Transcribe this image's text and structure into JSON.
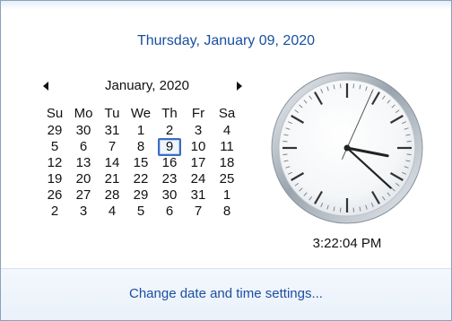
{
  "header": {
    "full_date": "Thursday, January 09, 2020"
  },
  "calendar": {
    "month_label": "January, 2020",
    "weekdays": [
      "Su",
      "Mo",
      "Tu",
      "We",
      "Th",
      "Fr",
      "Sa"
    ],
    "weeks": [
      [
        "29",
        "30",
        "31",
        "1",
        "2",
        "3",
        "4"
      ],
      [
        "5",
        "6",
        "7",
        "8",
        "9",
        "10",
        "11"
      ],
      [
        "12",
        "13",
        "14",
        "15",
        "16",
        "17",
        "18"
      ],
      [
        "19",
        "20",
        "21",
        "22",
        "23",
        "24",
        "25"
      ],
      [
        "26",
        "27",
        "28",
        "29",
        "30",
        "31",
        "1"
      ],
      [
        "2",
        "3",
        "4",
        "5",
        "6",
        "7",
        "8"
      ]
    ],
    "selected_day": "9",
    "prev_icon": "triangle-left-icon",
    "next_icon": "triangle-right-icon"
  },
  "clock": {
    "time_text": "3:22:04 PM",
    "hour": 3,
    "minute": 22,
    "second": 4
  },
  "footer": {
    "link_label": "Change date and time settings..."
  },
  "colors": {
    "accent": "#1a4fa0",
    "today_border": "#3a6cc7"
  }
}
